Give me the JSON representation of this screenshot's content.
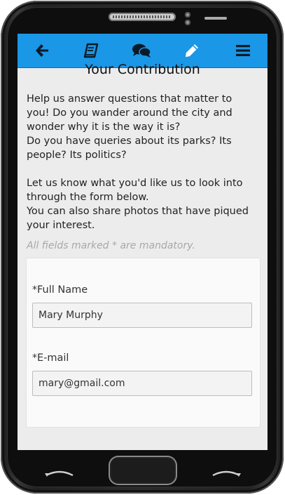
{
  "header": {
    "icons": [
      {
        "name": "back-arrow-icon"
      },
      {
        "name": "book-icon"
      },
      {
        "name": "chat-bubbles-icon"
      },
      {
        "name": "pencil-icon"
      },
      {
        "name": "hamburger-menu-icon"
      }
    ],
    "accent_color": "#1a97e6"
  },
  "page": {
    "title": "Your Contribution",
    "intro_1": "Help us answer questions that matter to you! Do you wander around the city and wonder why it is the way it is?",
    "intro_2": "Do you have queries about its parks? Its people? Its politics?",
    "intro_3": "Let us know what you'd like us to look into through the form below.",
    "intro_4": "You can also share photos that have piqued your interest.",
    "mandatory_note": "All fields marked * are mandatory."
  },
  "form": {
    "full_name": {
      "required_mark": "*",
      "label": "Full Name",
      "value": "Mary Murphy"
    },
    "email": {
      "required_mark": "*",
      "label": "E-mail",
      "value": "mary@gmail.com"
    }
  }
}
